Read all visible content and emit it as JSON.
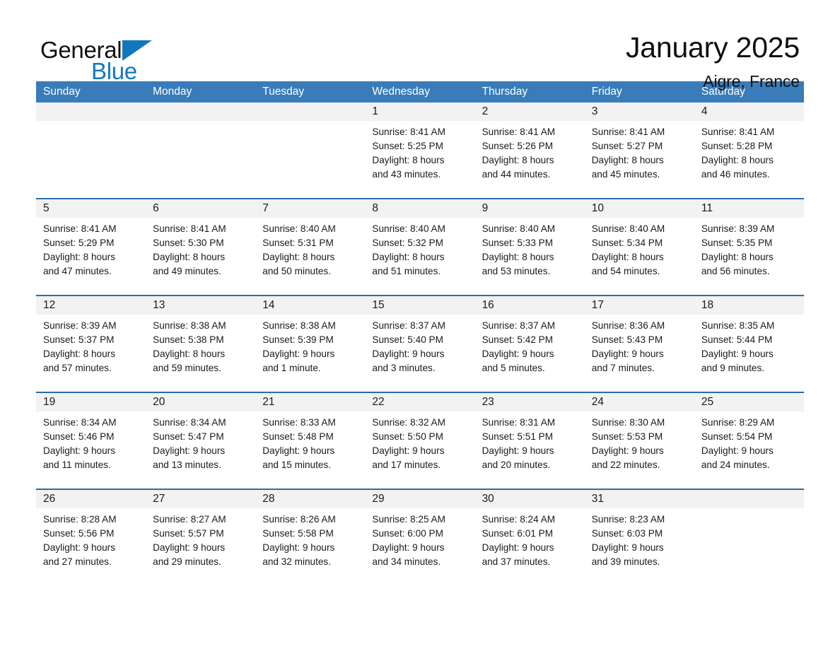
{
  "logo": {
    "word1": "General",
    "word2": "Blue",
    "triangle_icon": "blue-triangle-icon",
    "accent_color": "#1277bc"
  },
  "header": {
    "title": "January 2025",
    "subtitle": "Aigre, France"
  },
  "theme": {
    "header_blue": "#3a7cba",
    "row_divider_blue": "#2d6ca8",
    "daynum_band": "#f2f2f2",
    "text": "#1a1a1a"
  },
  "weekdays": [
    "Sunday",
    "Monday",
    "Tuesday",
    "Wednesday",
    "Thursday",
    "Friday",
    "Saturday"
  ],
  "weeks": [
    [
      {
        "day": "",
        "lines": []
      },
      {
        "day": "",
        "lines": []
      },
      {
        "day": "",
        "lines": []
      },
      {
        "day": "1",
        "lines": [
          "Sunrise: 8:41 AM",
          "Sunset: 5:25 PM",
          "Daylight: 8 hours",
          "and 43 minutes."
        ]
      },
      {
        "day": "2",
        "lines": [
          "Sunrise: 8:41 AM",
          "Sunset: 5:26 PM",
          "Daylight: 8 hours",
          "and 44 minutes."
        ]
      },
      {
        "day": "3",
        "lines": [
          "Sunrise: 8:41 AM",
          "Sunset: 5:27 PM",
          "Daylight: 8 hours",
          "and 45 minutes."
        ]
      },
      {
        "day": "4",
        "lines": [
          "Sunrise: 8:41 AM",
          "Sunset: 5:28 PM",
          "Daylight: 8 hours",
          "and 46 minutes."
        ]
      }
    ],
    [
      {
        "day": "5",
        "lines": [
          "Sunrise: 8:41 AM",
          "Sunset: 5:29 PM",
          "Daylight: 8 hours",
          "and 47 minutes."
        ]
      },
      {
        "day": "6",
        "lines": [
          "Sunrise: 8:41 AM",
          "Sunset: 5:30 PM",
          "Daylight: 8 hours",
          "and 49 minutes."
        ]
      },
      {
        "day": "7",
        "lines": [
          "Sunrise: 8:40 AM",
          "Sunset: 5:31 PM",
          "Daylight: 8 hours",
          "and 50 minutes."
        ]
      },
      {
        "day": "8",
        "lines": [
          "Sunrise: 8:40 AM",
          "Sunset: 5:32 PM",
          "Daylight: 8 hours",
          "and 51 minutes."
        ]
      },
      {
        "day": "9",
        "lines": [
          "Sunrise: 8:40 AM",
          "Sunset: 5:33 PM",
          "Daylight: 8 hours",
          "and 53 minutes."
        ]
      },
      {
        "day": "10",
        "lines": [
          "Sunrise: 8:40 AM",
          "Sunset: 5:34 PM",
          "Daylight: 8 hours",
          "and 54 minutes."
        ]
      },
      {
        "day": "11",
        "lines": [
          "Sunrise: 8:39 AM",
          "Sunset: 5:35 PM",
          "Daylight: 8 hours",
          "and 56 minutes."
        ]
      }
    ],
    [
      {
        "day": "12",
        "lines": [
          "Sunrise: 8:39 AM",
          "Sunset: 5:37 PM",
          "Daylight: 8 hours",
          "and 57 minutes."
        ]
      },
      {
        "day": "13",
        "lines": [
          "Sunrise: 8:38 AM",
          "Sunset: 5:38 PM",
          "Daylight: 8 hours",
          "and 59 minutes."
        ]
      },
      {
        "day": "14",
        "lines": [
          "Sunrise: 8:38 AM",
          "Sunset: 5:39 PM",
          "Daylight: 9 hours",
          "and 1 minute."
        ]
      },
      {
        "day": "15",
        "lines": [
          "Sunrise: 8:37 AM",
          "Sunset: 5:40 PM",
          "Daylight: 9 hours",
          "and 3 minutes."
        ]
      },
      {
        "day": "16",
        "lines": [
          "Sunrise: 8:37 AM",
          "Sunset: 5:42 PM",
          "Daylight: 9 hours",
          "and 5 minutes."
        ]
      },
      {
        "day": "17",
        "lines": [
          "Sunrise: 8:36 AM",
          "Sunset: 5:43 PM",
          "Daylight: 9 hours",
          "and 7 minutes."
        ]
      },
      {
        "day": "18",
        "lines": [
          "Sunrise: 8:35 AM",
          "Sunset: 5:44 PM",
          "Daylight: 9 hours",
          "and 9 minutes."
        ]
      }
    ],
    [
      {
        "day": "19",
        "lines": [
          "Sunrise: 8:34 AM",
          "Sunset: 5:46 PM",
          "Daylight: 9 hours",
          "and 11 minutes."
        ]
      },
      {
        "day": "20",
        "lines": [
          "Sunrise: 8:34 AM",
          "Sunset: 5:47 PM",
          "Daylight: 9 hours",
          "and 13 minutes."
        ]
      },
      {
        "day": "21",
        "lines": [
          "Sunrise: 8:33 AM",
          "Sunset: 5:48 PM",
          "Daylight: 9 hours",
          "and 15 minutes."
        ]
      },
      {
        "day": "22",
        "lines": [
          "Sunrise: 8:32 AM",
          "Sunset: 5:50 PM",
          "Daylight: 9 hours",
          "and 17 minutes."
        ]
      },
      {
        "day": "23",
        "lines": [
          "Sunrise: 8:31 AM",
          "Sunset: 5:51 PM",
          "Daylight: 9 hours",
          "and 20 minutes."
        ]
      },
      {
        "day": "24",
        "lines": [
          "Sunrise: 8:30 AM",
          "Sunset: 5:53 PM",
          "Daylight: 9 hours",
          "and 22 minutes."
        ]
      },
      {
        "day": "25",
        "lines": [
          "Sunrise: 8:29 AM",
          "Sunset: 5:54 PM",
          "Daylight: 9 hours",
          "and 24 minutes."
        ]
      }
    ],
    [
      {
        "day": "26",
        "lines": [
          "Sunrise: 8:28 AM",
          "Sunset: 5:56 PM",
          "Daylight: 9 hours",
          "and 27 minutes."
        ]
      },
      {
        "day": "27",
        "lines": [
          "Sunrise: 8:27 AM",
          "Sunset: 5:57 PM",
          "Daylight: 9 hours",
          "and 29 minutes."
        ]
      },
      {
        "day": "28",
        "lines": [
          "Sunrise: 8:26 AM",
          "Sunset: 5:58 PM",
          "Daylight: 9 hours",
          "and 32 minutes."
        ]
      },
      {
        "day": "29",
        "lines": [
          "Sunrise: 8:25 AM",
          "Sunset: 6:00 PM",
          "Daylight: 9 hours",
          "and 34 minutes."
        ]
      },
      {
        "day": "30",
        "lines": [
          "Sunrise: 8:24 AM",
          "Sunset: 6:01 PM",
          "Daylight: 9 hours",
          "and 37 minutes."
        ]
      },
      {
        "day": "31",
        "lines": [
          "Sunrise: 8:23 AM",
          "Sunset: 6:03 PM",
          "Daylight: 9 hours",
          "and 39 minutes."
        ]
      },
      {
        "day": "",
        "lines": []
      }
    ]
  ]
}
